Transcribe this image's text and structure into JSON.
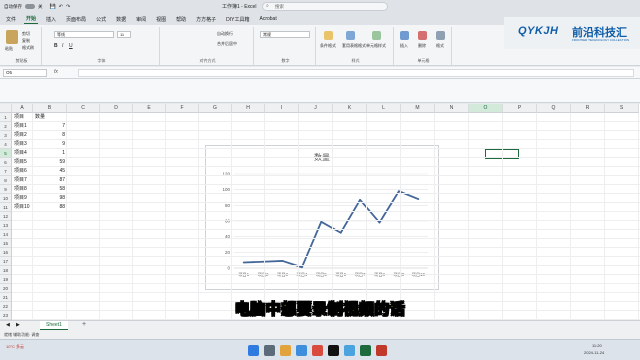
{
  "titlebar": {
    "autosave_label": "自动保存",
    "autosave_state": "关",
    "title": "工作簿1 - Excel",
    "search_placeholder": "搜索"
  },
  "menu": {
    "items": [
      "文件",
      "开始",
      "插入",
      "页面布局",
      "公式",
      "数据",
      "审阅",
      "视图",
      "帮助",
      "方方格子",
      "DIY工具箱",
      "Acrobat"
    ],
    "active": "开始"
  },
  "ribbon": {
    "clipboard": {
      "paste": "粘贴",
      "cut": "剪切",
      "copy": "复制",
      "format": "格式刷",
      "label": "剪贴板"
    },
    "font": {
      "name": "等线",
      "size": "11",
      "label": "字体"
    },
    "align": {
      "wrap": "自动换行",
      "merge": "合并后居中",
      "label": "对齐方式"
    },
    "number": {
      "format": "常规",
      "label": "数字"
    },
    "styles": {
      "cond": "条件格式",
      "table": "套用表格格式",
      "cellstyle": "单元格样式",
      "label": "样式"
    },
    "cells": {
      "insert": "插入",
      "delete": "删除",
      "format": "格式",
      "label": "单元格"
    }
  },
  "logo": {
    "brand": "QYKJH",
    "name": "前沿科技汇",
    "tagline": "FRONTIER TECHNOLOGY COLLECTION"
  },
  "formula": {
    "namebox": "O5",
    "fx": "fx"
  },
  "columns": [
    "A",
    "B",
    "C",
    "D",
    "E",
    "F",
    "G",
    "H",
    "I",
    "J",
    "K",
    "L",
    "M",
    "N",
    "O",
    "P",
    "Q",
    "R",
    "S"
  ],
  "rows": [
    "1",
    "2",
    "3",
    "4",
    "5",
    "6",
    "7",
    "8",
    "9",
    "10",
    "11",
    "12",
    "13",
    "14",
    "15",
    "16",
    "17",
    "18",
    "19",
    "20",
    "21",
    "22",
    "23"
  ],
  "table": {
    "header": [
      "项目",
      "数量"
    ],
    "rows": [
      [
        "项目1",
        "7"
      ],
      [
        "项目2",
        "8"
      ],
      [
        "项目3",
        "9"
      ],
      [
        "项目4",
        "1"
      ],
      [
        "项目5",
        "59"
      ],
      [
        "项目6",
        "45"
      ],
      [
        "项目7",
        "87"
      ],
      [
        "项目8",
        "58"
      ],
      [
        "项目9",
        "98"
      ],
      [
        "项目10",
        "88"
      ]
    ]
  },
  "chart_data": {
    "type": "line",
    "title": "数量",
    "categories": [
      "项目1",
      "项目2",
      "项目3",
      "项目4",
      "项目5",
      "项目6",
      "项目7",
      "项目8",
      "项目9",
      "项目10"
    ],
    "series": [
      {
        "values": [
          7,
          8,
          9,
          1,
          59,
          45,
          87,
          58,
          98,
          88
        ],
        "color": "#44679a"
      }
    ],
    "ylim": [
      0,
      120
    ],
    "yticks": [
      0,
      20,
      40,
      60,
      80,
      100,
      120
    ],
    "grid": true
  },
  "sheet": {
    "tab": "Sheet1",
    "add": "+"
  },
  "status": {
    "text": "就绪   辅助功能: 调查"
  },
  "subtitle": "电脑中想要录制视频的话",
  "taskbar": {
    "weather": "10°C 多云",
    "time": "11:20",
    "date": "2024-11-24"
  },
  "colors": {
    "excel_green": "#1d6b3c",
    "line": "#44679a",
    "subtitle": "#ffd814"
  }
}
